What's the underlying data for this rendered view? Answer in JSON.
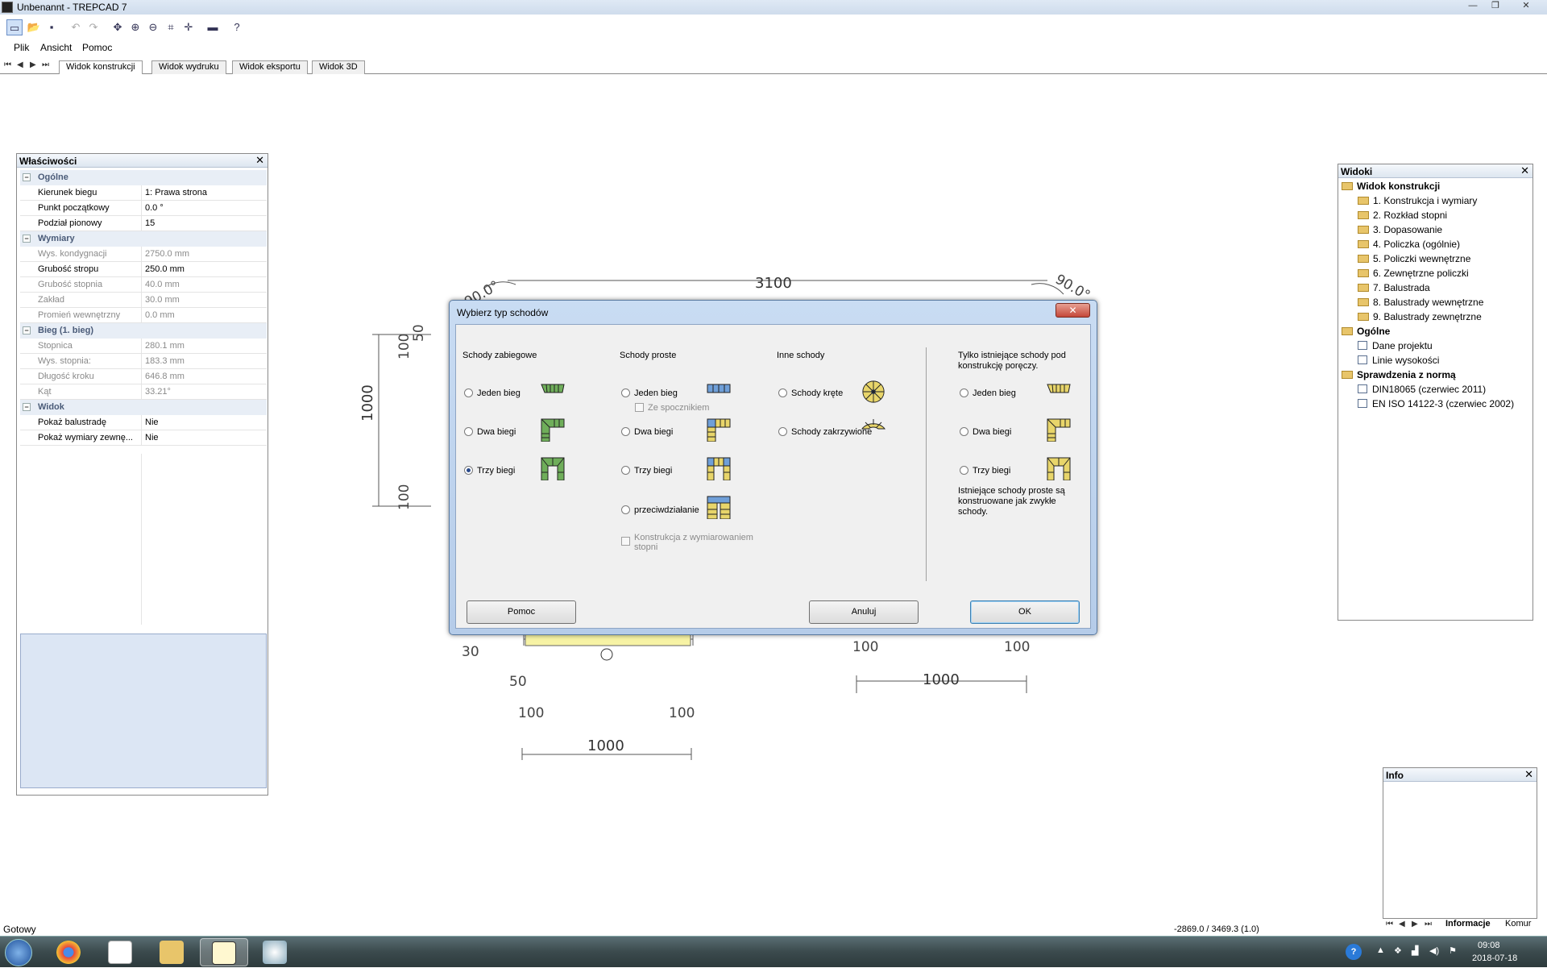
{
  "window": {
    "title": "Unbenannt - TREPCAD 7",
    "controls": {
      "minimize": "—",
      "restore": "❐",
      "close": "✕"
    }
  },
  "toolbar": {
    "icons": [
      "new-icon",
      "open-icon",
      "save-icon",
      "undo-icon",
      "redo-icon",
      "pan-icon",
      "zoom-in-icon",
      "zoom-out-icon",
      "zoom-window-icon",
      "zoom-fit-icon",
      "measure-icon",
      "help-icon"
    ]
  },
  "menu": {
    "items": [
      "Plik",
      "Ansicht",
      "Pomoc"
    ]
  },
  "tabs": {
    "nav": [
      "⏮",
      "◀",
      "▶",
      "⏭"
    ],
    "items": [
      "Widok konstrukcji",
      "Widok wydruku",
      "Widok eksportu",
      "Widok 3D"
    ],
    "active": 0
  },
  "properties": {
    "title": "Właściwości",
    "sections": [
      {
        "name": "Ogólne",
        "rows": [
          {
            "key": "Kierunek biegu",
            "value": "1: Prawa strona",
            "disabled": false
          },
          {
            "key": "Punkt początkowy",
            "value": "0.0 °",
            "disabled": false
          },
          {
            "key": "Podział pionowy",
            "value": "15",
            "disabled": false
          }
        ]
      },
      {
        "name": "Wymiary",
        "rows": [
          {
            "key": "Wys. kondygnacji",
            "value": "2750.0 mm",
            "disabled": true
          },
          {
            "key": "Grubość stropu",
            "value": "250.0 mm",
            "disabled": false
          },
          {
            "key": "Grubość stopnia",
            "value": "40.0 mm",
            "disabled": true
          },
          {
            "key": "Zakład",
            "value": "30.0 mm",
            "disabled": true
          },
          {
            "key": "Promień wewnętrzny",
            "value": "0.0 mm",
            "disabled": true
          }
        ]
      },
      {
        "name": "Bieg (1. bieg)",
        "rows": [
          {
            "key": "Stopnica",
            "value": "280.1 mm",
            "disabled": true
          },
          {
            "key": "Wys. stopnia:",
            "value": "183.3 mm",
            "disabled": true
          },
          {
            "key": "Długość kroku",
            "value": "646.8 mm",
            "disabled": true
          },
          {
            "key": "Kąt",
            "value": "33.21°",
            "disabled": true
          }
        ]
      },
      {
        "name": "Widok",
        "rows": [
          {
            "key": "Pokaż balustradę",
            "value": "Nie",
            "disabled": false
          },
          {
            "key": "Pokaż wymiary zewnę...",
            "value": "Nie",
            "disabled": false
          }
        ]
      }
    ]
  },
  "views": {
    "title": "Widoki",
    "groups": [
      {
        "name": "Widok konstrukcji",
        "items": [
          "1. Konstrukcja i wymiary",
          "2. Rozkład stopni",
          "3. Dopasowanie",
          "4. Policzka (ogólnie)",
          "5. Policzki wewnętrzne",
          "6. Zewnętrzne policzki",
          "7. Balustrada",
          "8. Balustrady wewnętrzne",
          "9. Balustrady zewnętrzne"
        ]
      },
      {
        "name": "Ogólne",
        "items": [
          "Dane projektu",
          "Linie wysokości"
        ]
      },
      {
        "name": "Sprawdzenia z normą",
        "items": [
          "DIN18065 (czerwiec 2011)",
          "EN ISO 14122-3 (czerwiec 2002)"
        ]
      }
    ]
  },
  "drawing": {
    "dims": {
      "top": "3100",
      "angle_left": "90.0°",
      "angle_right": "90.0°",
      "left_height": "1000",
      "left_100_top": "100",
      "left_100_bottom": "100",
      "left_50": "50",
      "bl_30": "30",
      "bl_50": "50",
      "bl_100a": "100",
      "bl_100b": "100",
      "bl_1000": "1000",
      "br_100a": "100",
      "br_100b": "100",
      "br_1000": "1000"
    }
  },
  "dialog": {
    "title": "Wybierz typ schodów",
    "close": "✕",
    "groups": {
      "winding": {
        "title": "Schody zabiegowe",
        "options": [
          "Jeden bieg",
          "Dwa biegi",
          "Trzy biegi"
        ],
        "selected": 2
      },
      "straight": {
        "title": "Schody proste",
        "options": [
          "Jeden bieg",
          "Dwa biegi",
          "Trzy biegi",
          "przeciwdziałanie"
        ],
        "landing_checkbox": "Ze spocznikiem",
        "dimension_checkbox": "Konstrukcja z wymiarowaniem stopni"
      },
      "other": {
        "title": "Inne schody",
        "options": [
          "Schody kręte",
          "Schody zakrzywione"
        ]
      },
      "existing": {
        "title": "Tylko istniejące schody pod konstrukcję poręczy.",
        "options": [
          "Jeden bieg",
          "Dwa biegi",
          "Trzy biegi"
        ],
        "note": "Istniejące schody proste są konstruowane jak zwykłe schody."
      }
    },
    "buttons": {
      "help": "Pomoc",
      "cancel": "Anuluj",
      "ok": "OK"
    }
  },
  "info": {
    "title": "Info",
    "nav": [
      "⏮",
      "◀",
      "▶",
      "⏭"
    ],
    "tabs": [
      "Informacje",
      "Komur"
    ]
  },
  "status": {
    "left": "Gotowy",
    "coords": "-2869.0 / 3469.3 (1.0)"
  },
  "taskbar": {
    "apps": [
      "windows-start",
      "chrome",
      "simplex",
      "file-explorer",
      "trepcad",
      "paint"
    ],
    "clock_time": "09:08",
    "clock_date": "2018-07-18"
  },
  "colors": {
    "accent": "#3c7fb1",
    "panel_header": "#dde6f0",
    "dialog_frame": "#b5cce9",
    "stair_green": "#6fae5a",
    "stair_blue": "#6f9fd8",
    "stair_yellow": "#e8d56a"
  }
}
